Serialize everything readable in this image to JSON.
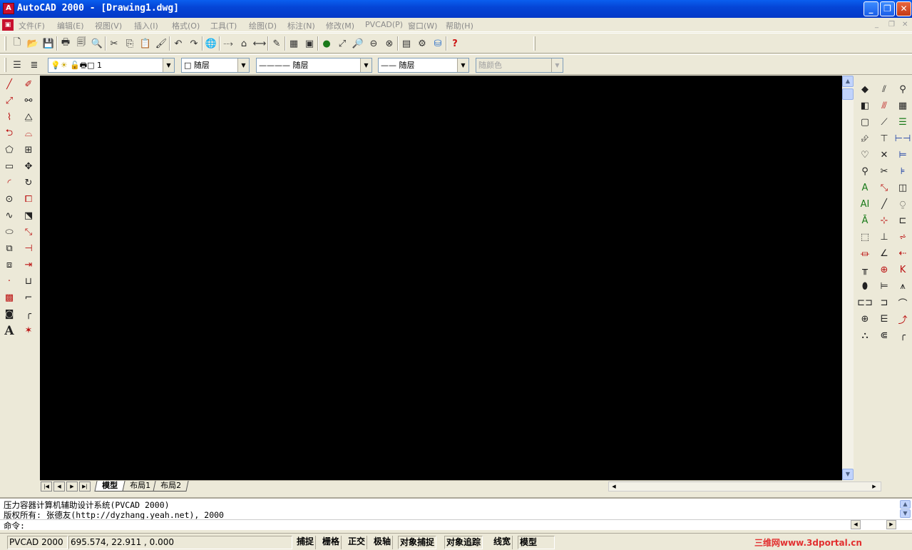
{
  "window": {
    "title": "AutoCAD 2000 - [Drawing1.dwg]",
    "minimize": "_",
    "restore": "❐",
    "close": "✕"
  },
  "menu": [
    {
      "label": "文件(F)"
    },
    {
      "label": "编辑(E)"
    },
    {
      "label": "视图(V)"
    },
    {
      "label": "插入(I)"
    },
    {
      "label": "格式(O)"
    },
    {
      "label": "工具(T)"
    },
    {
      "label": "绘图(D)"
    },
    {
      "label": "标注(N)"
    },
    {
      "label": "修改(M)"
    },
    {
      "label": "PVCAD(P)"
    },
    {
      "label": "窗口(W)"
    },
    {
      "label": "帮助(H)"
    }
  ],
  "properties": {
    "layer_value": "1",
    "color_value": "随层",
    "linetype_value": "———— 随层",
    "lineweight_value": "—— 随层",
    "plotstyle_value": "随颜色"
  },
  "layout_tabs": [
    {
      "label": "模型",
      "active": true
    },
    {
      "label": "布局1",
      "active": false
    },
    {
      "label": "布局2",
      "active": false
    }
  ],
  "command": {
    "line1": "压力容器计算机辅助设计系统(PVCAD 2000)",
    "line2": "版权所有: 张德友(http://dyzhang.yeah.net), 2000",
    "prompt": "命令:"
  },
  "status": {
    "app": "PVCAD 2000",
    "coords": "695.574, 22.911 , 0.000",
    "toggles": [
      "捕捉",
      "栅格",
      "正交",
      "极轴",
      "对象捕捉",
      "对象追踪",
      "线宽",
      "模型"
    ],
    "watermark": "三维网www.3dportal.cn"
  },
  "colors": {
    "titlebar": "#0545D6",
    "canvas": "#000000",
    "chrome": "#ECE9D8",
    "watermark": "#E23030"
  }
}
